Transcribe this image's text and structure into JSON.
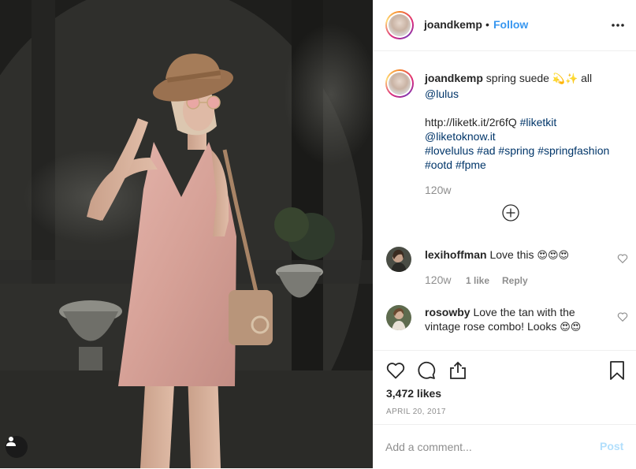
{
  "post": {
    "username": "joandkemp",
    "separator": "•",
    "follow_label": "Follow",
    "more_icon": "more-horizontal-icon"
  },
  "caption": {
    "username": "joandkemp",
    "text_part1": "spring suede ",
    "emoji1": "💫✨",
    "text_part2": " all",
    "mention": "@lulus",
    "url": "http://liketk.it/2r6fQ",
    "tag_liketkit": "#liketkit",
    "mention2": "@liketoknow.it",
    "tags_line1": [
      "#lovelulus",
      "#ad",
      "#spring",
      "#springfashion"
    ],
    "tags_line2": [
      "#ootd",
      "#fpme"
    ],
    "timestamp": "120w"
  },
  "comments": [
    {
      "username": "lexihoffman",
      "text": "Love this ",
      "emoji": "😍😍😍",
      "timestamp": "120w",
      "likes": "1 like",
      "reply_label": "Reply"
    },
    {
      "username": "rosowby",
      "text": "Love the tan with the vintage rose combo! Looks ",
      "emoji": "😍😍"
    }
  ],
  "actions": {
    "likes": "3,472 likes",
    "date": "APRIL 20, 2017"
  },
  "add_comment": {
    "placeholder": "Add a comment...",
    "post_label": "Post"
  },
  "colors": {
    "link": "#003569",
    "follow": "#3897f0",
    "post_disabled": "#b2dffc",
    "muted": "#8e8e8e",
    "dress": "#d9a79f",
    "hat": "#a57c59"
  }
}
